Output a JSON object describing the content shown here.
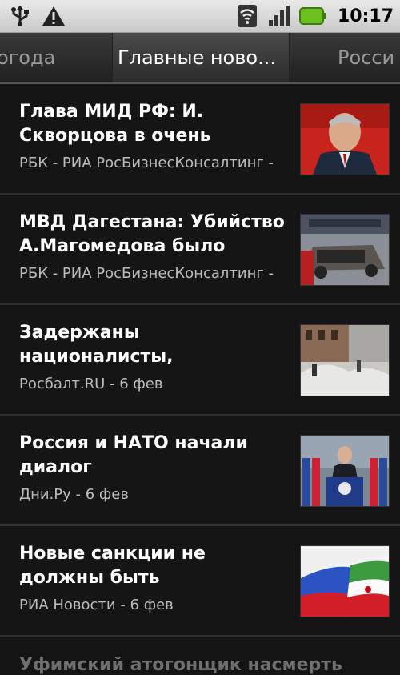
{
  "status_bar": {
    "time": "10:17",
    "icons": [
      "usb-icon",
      "warning-icon",
      "wifi-icon",
      "signal-icon",
      "battery-icon"
    ]
  },
  "tabs": {
    "left_partial": "огода",
    "active": "Главные ново...",
    "right_partial": "Росси"
  },
  "news": [
    {
      "title": "Глава МИД РФ: И. Скворцова в очень",
      "source": "РБК - РИА РосБизнесКонсалтинг -"
    },
    {
      "title": "МВД Дагестана: Убийство А.Магомедова было",
      "source": "РБК - РИА РосБизнесКонсалтинг -"
    },
    {
      "title": "Задержаны националисты,",
      "source": "Росбалт.RU - 6 фев"
    },
    {
      "title": "Россия и НАТО начали диалог",
      "source": "Дни.Ру - 6 фев"
    },
    {
      "title": "Новые санкции не должны быть",
      "source": "РИА Новости - 6 фев"
    }
  ],
  "partial_item": "Уфимский атогонщик насмерть"
}
